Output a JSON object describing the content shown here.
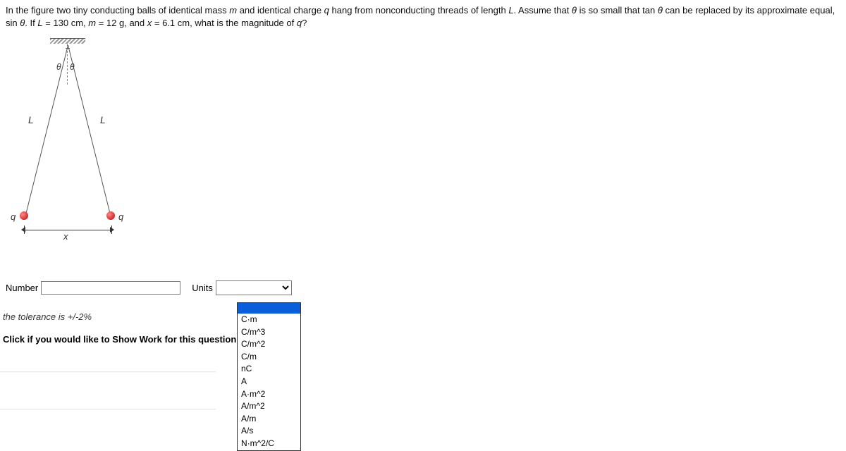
{
  "problem": {
    "text_parts": {
      "p1": "In the figure two tiny conducting balls of identical mass ",
      "m1": "m",
      "p2": " and identical charge ",
      "q1": "q",
      "p3": " hang from nonconducting threads of length ",
      "L1": "L",
      "p4": ". Assume that ",
      "th1": "θ",
      "p5": " is so small that tan ",
      "th2": "θ",
      "p6": " can be replaced by its approximate equal, sin ",
      "th3": "θ",
      "p7": ". If ",
      "L2": "L",
      "p8": " = 130 cm, ",
      "m2": "m",
      "p9": " = 12 g, and ",
      "x1": "x",
      "p10": " = 6.1 cm, what is the magnitude of ",
      "q2": "q",
      "p11": "?"
    }
  },
  "figure": {
    "theta_left": "θ",
    "theta_right": "θ",
    "L_left": "L",
    "L_right": "L",
    "q_left": "q",
    "q_right": "q",
    "x_label": "x"
  },
  "answer": {
    "number_label": "Number",
    "number_value": "",
    "units_label": "Units",
    "units_value": ""
  },
  "tolerance_text": "the tolerance is +/-2%",
  "show_work_text": "Click if you would like to Show Work for this question:",
  "units_options": [
    "",
    "C·m",
    "C/m^3",
    "C/m^2",
    "C/m",
    "nC",
    "A",
    "A·m^2",
    "A/m^2",
    "A/m",
    "A/s",
    "N·m^2/C"
  ]
}
